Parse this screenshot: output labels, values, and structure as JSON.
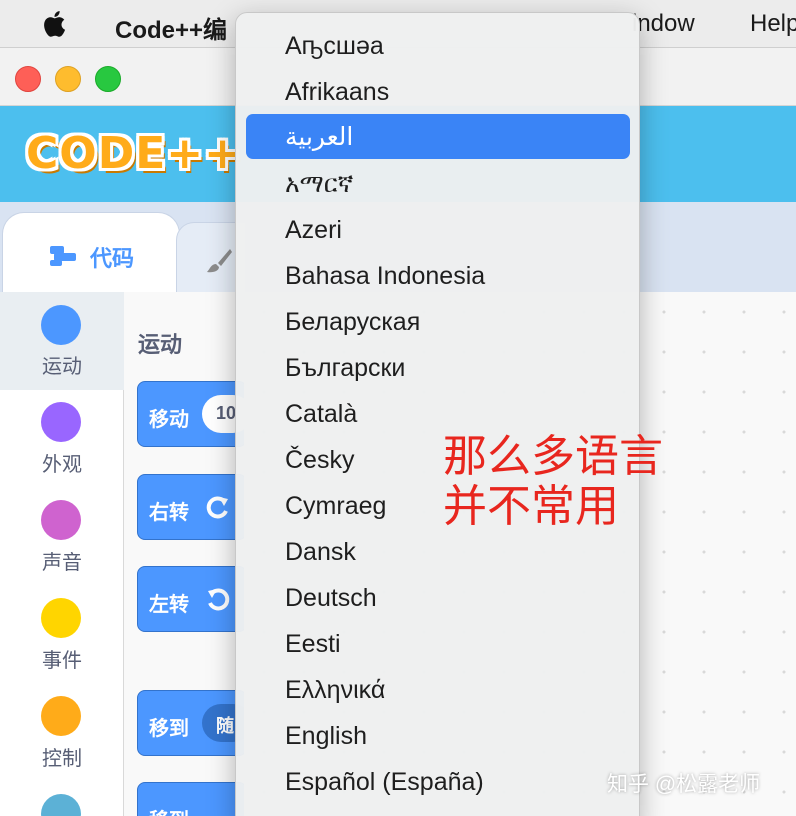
{
  "menubar": {
    "app_name": "Code++编",
    "window_menu": "indow",
    "help_menu": "Help"
  },
  "app": {
    "logo_text": "CODE++",
    "tabs": [
      {
        "label": "代码",
        "icon": "code-blocks-icon",
        "active": true
      },
      {
        "label": "",
        "icon": "brush-icon",
        "active": false
      }
    ]
  },
  "categories": [
    {
      "label": "运动",
      "color": "#4c97ff"
    },
    {
      "label": "外观",
      "color": "#9966ff"
    },
    {
      "label": "声音",
      "color": "#cf63cf"
    },
    {
      "label": "事件",
      "color": "#ffd500"
    },
    {
      "label": "控制",
      "color": "#ffab19"
    },
    {
      "label": "",
      "color": "#5cb1d6"
    }
  ],
  "palette": {
    "section_title": "运动",
    "blocks": [
      {
        "label": "移动",
        "arg": "10"
      },
      {
        "label": "右转",
        "arg": "rotate-right-icon"
      },
      {
        "label": "左转",
        "arg": "rotate-left-icon"
      },
      {
        "label": "移到",
        "arg": "随"
      },
      {
        "label": "移到 x:",
        "arg": ""
      }
    ]
  },
  "language_menu": {
    "selected_index": 2,
    "items": [
      "Аҧсшәа",
      "Afrikaans",
      "العربية",
      "አማርኛ",
      "Azeri",
      "Bahasa Indonesia",
      "Беларуская",
      "Български",
      "Català",
      "Česky",
      "Cymraeg",
      "Dansk",
      "Deutsch",
      "Eesti",
      "Ελληνικά",
      "English",
      "Español (España)"
    ]
  },
  "annotation": {
    "line1": "那么多语言",
    "line2": "并不常用",
    "color": "#e8261e"
  },
  "watermark": "知乎 @松露老师",
  "colors": {
    "accent": "#4c97ff",
    "header": "#4cbfee",
    "highlight": "#3a84f6"
  }
}
